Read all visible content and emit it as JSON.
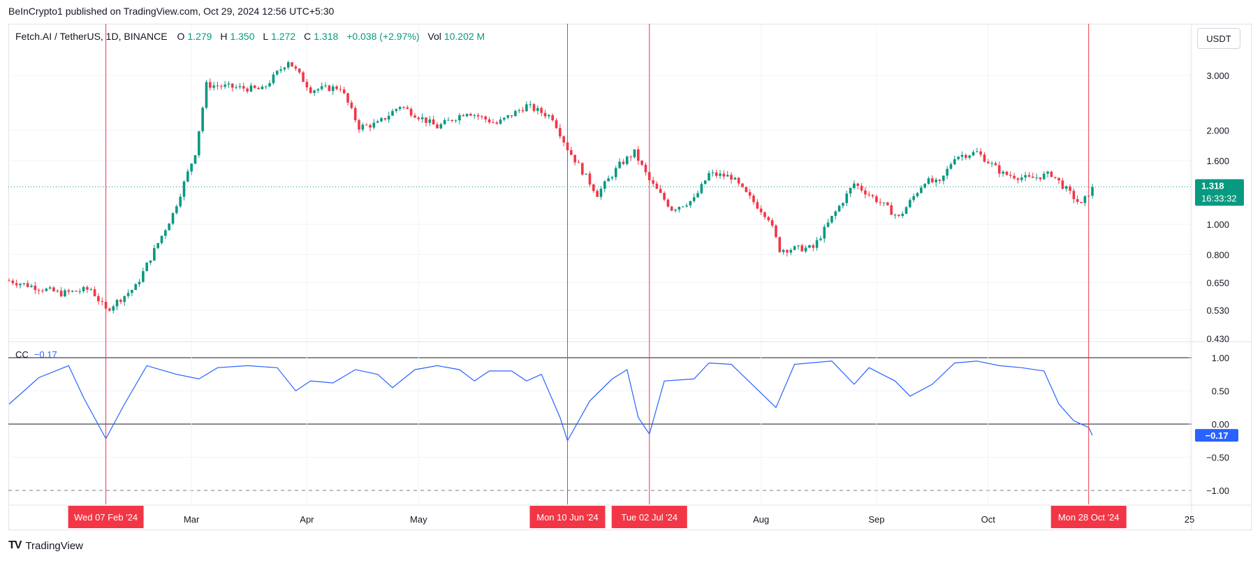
{
  "header": {
    "published": "BeInCrypto1 published on TradingView.com, Oct 29, 2024 12:56 UTC+5:30"
  },
  "legend": {
    "symbol": "Fetch.AI / TetherUS, 1D, BINANCE",
    "o_label": "O",
    "o_value": "1.279",
    "h_label": "H",
    "h_value": "1.350",
    "l_label": "L",
    "l_value": "1.272",
    "c_label": "C",
    "c_value": "1.318",
    "change": "+0.038 (+2.97%)",
    "vol_label": "Vol",
    "vol_value": "10.202 M"
  },
  "currency_button": "USDT",
  "price_tag": {
    "price": "1.318",
    "countdown": "16:33:32"
  },
  "indicator": {
    "name": "CC",
    "value": "−0.17",
    "tag": "−0.17"
  },
  "footer": {
    "logo": "TV",
    "brand": "TradingView"
  },
  "colors": {
    "up": "#089981",
    "down": "#f23645",
    "cc_line": "#2962ff",
    "marker_line": "#f23645",
    "marker_bg": "#f23645",
    "price_tag_bg": "#089981"
  },
  "chart_data": [
    {
      "type": "candlestick",
      "title": "Fetch.AI / TetherUS, 1D, BINANCE",
      "y_scale": "log",
      "y_ticks": [
        "3.000",
        "2.000",
        "1.600",
        "1.000",
        "0.800",
        "0.650",
        "0.530",
        "0.430"
      ],
      "x_ticks": [
        "Mar",
        "Apr",
        "May",
        "Aug",
        "Sep",
        "Oct",
        "25"
      ],
      "last_price": 1.318,
      "close_path": [
        {
          "date": "2024-01-12",
          "close": 0.66
        },
        {
          "date": "2024-01-26",
          "close": 0.6
        },
        {
          "date": "2024-02-03",
          "close": 0.62
        },
        {
          "date": "2024-02-07",
          "close": 0.53
        },
        {
          "date": "2024-02-15",
          "close": 0.63
        },
        {
          "date": "2024-02-25",
          "close": 1.08
        },
        {
          "date": "2024-03-02",
          "close": 1.7
        },
        {
          "date": "2024-03-05",
          "close": 2.8
        },
        {
          "date": "2024-03-12",
          "close": 2.75
        },
        {
          "date": "2024-03-20",
          "close": 2.7
        },
        {
          "date": "2024-03-27",
          "close": 3.35
        },
        {
          "date": "2024-04-02",
          "close": 2.7
        },
        {
          "date": "2024-04-10",
          "close": 2.75
        },
        {
          "date": "2024-04-15",
          "close": 2.05
        },
        {
          "date": "2024-04-20",
          "close": 2.1
        },
        {
          "date": "2024-04-26",
          "close": 2.4
        },
        {
          "date": "2024-05-06",
          "close": 2.05
        },
        {
          "date": "2024-05-14",
          "close": 2.3
        },
        {
          "date": "2024-05-22",
          "close": 2.1
        },
        {
          "date": "2024-05-30",
          "close": 2.4
        },
        {
          "date": "2024-06-06",
          "close": 2.2
        },
        {
          "date": "2024-06-10",
          "close": 1.75
        },
        {
          "date": "2024-06-18",
          "close": 1.25
        },
        {
          "date": "2024-06-24",
          "close": 1.55
        },
        {
          "date": "2024-06-28",
          "close": 1.7
        },
        {
          "date": "2024-07-02",
          "close": 1.38
        },
        {
          "date": "2024-07-08",
          "close": 1.12
        },
        {
          "date": "2024-07-14",
          "close": 1.2
        },
        {
          "date": "2024-07-18",
          "close": 1.45
        },
        {
          "date": "2024-07-24",
          "close": 1.42
        },
        {
          "date": "2024-07-28",
          "close": 1.25
        },
        {
          "date": "2024-08-03",
          "close": 1.05
        },
        {
          "date": "2024-08-06",
          "close": 0.83
        },
        {
          "date": "2024-08-15",
          "close": 0.84
        },
        {
          "date": "2024-08-20",
          "close": 1.05
        },
        {
          "date": "2024-08-26",
          "close": 1.35
        },
        {
          "date": "2024-09-03",
          "close": 1.15
        },
        {
          "date": "2024-09-07",
          "close": 1.05
        },
        {
          "date": "2024-09-14",
          "close": 1.38
        },
        {
          "date": "2024-09-18",
          "close": 1.35
        },
        {
          "date": "2024-09-22",
          "close": 1.65
        },
        {
          "date": "2024-09-28",
          "close": 1.7
        },
        {
          "date": "2024-10-05",
          "close": 1.45
        },
        {
          "date": "2024-10-12",
          "close": 1.4
        },
        {
          "date": "2024-10-18",
          "close": 1.45
        },
        {
          "date": "2024-10-26",
          "close": 1.15
        },
        {
          "date": "2024-10-29",
          "close": 1.318
        }
      ]
    },
    {
      "type": "line",
      "name": "CC",
      "y_ticks": [
        "1.00",
        "0.50",
        "0.00",
        "−0.50",
        "−1.00"
      ],
      "ylim": [
        -1.0,
        1.0
      ],
      "last_value": -0.17,
      "series": [
        {
          "date": "2024-01-12",
          "value": 0.3
        },
        {
          "date": "2024-01-20",
          "value": 0.7
        },
        {
          "date": "2024-01-28",
          "value": 0.88
        },
        {
          "date": "2024-02-01",
          "value": 0.4
        },
        {
          "date": "2024-02-07",
          "value": -0.22
        },
        {
          "date": "2024-02-12",
          "value": 0.3
        },
        {
          "date": "2024-02-18",
          "value": 0.88
        },
        {
          "date": "2024-02-26",
          "value": 0.75
        },
        {
          "date": "2024-03-03",
          "value": 0.68
        },
        {
          "date": "2024-03-08",
          "value": 0.85
        },
        {
          "date": "2024-03-16",
          "value": 0.88
        },
        {
          "date": "2024-03-24",
          "value": 0.85
        },
        {
          "date": "2024-03-29",
          "value": 0.5
        },
        {
          "date": "2024-04-02",
          "value": 0.65
        },
        {
          "date": "2024-04-08",
          "value": 0.62
        },
        {
          "date": "2024-04-14",
          "value": 0.82
        },
        {
          "date": "2024-04-20",
          "value": 0.75
        },
        {
          "date": "2024-04-24",
          "value": 0.55
        },
        {
          "date": "2024-04-30",
          "value": 0.82
        },
        {
          "date": "2024-05-06",
          "value": 0.88
        },
        {
          "date": "2024-05-12",
          "value": 0.82
        },
        {
          "date": "2024-05-16",
          "value": 0.65
        },
        {
          "date": "2024-05-20",
          "value": 0.8
        },
        {
          "date": "2024-05-26",
          "value": 0.8
        },
        {
          "date": "2024-05-30",
          "value": 0.65
        },
        {
          "date": "2024-06-03",
          "value": 0.75
        },
        {
          "date": "2024-06-08",
          "value": 0.1
        },
        {
          "date": "2024-06-10",
          "value": -0.25
        },
        {
          "date": "2024-06-16",
          "value": 0.35
        },
        {
          "date": "2024-06-22",
          "value": 0.68
        },
        {
          "date": "2024-06-26",
          "value": 0.82
        },
        {
          "date": "2024-06-29",
          "value": 0.1
        },
        {
          "date": "2024-07-02",
          "value": -0.15
        },
        {
          "date": "2024-07-06",
          "value": 0.65
        },
        {
          "date": "2024-07-14",
          "value": 0.68
        },
        {
          "date": "2024-07-18",
          "value": 0.92
        },
        {
          "date": "2024-07-24",
          "value": 0.9
        },
        {
          "date": "2024-08-05",
          "value": 0.25
        },
        {
          "date": "2024-08-10",
          "value": 0.9
        },
        {
          "date": "2024-08-20",
          "value": 0.95
        },
        {
          "date": "2024-08-26",
          "value": 0.6
        },
        {
          "date": "2024-08-30",
          "value": 0.85
        },
        {
          "date": "2024-09-06",
          "value": 0.65
        },
        {
          "date": "2024-09-10",
          "value": 0.42
        },
        {
          "date": "2024-09-16",
          "value": 0.6
        },
        {
          "date": "2024-09-22",
          "value": 0.92
        },
        {
          "date": "2024-09-28",
          "value": 0.95
        },
        {
          "date": "2024-10-04",
          "value": 0.88
        },
        {
          "date": "2024-10-10",
          "value": 0.85
        },
        {
          "date": "2024-10-16",
          "value": 0.8
        },
        {
          "date": "2024-10-20",
          "value": 0.3
        },
        {
          "date": "2024-10-24",
          "value": 0.05
        },
        {
          "date": "2024-10-28",
          "value": -0.05
        },
        {
          "date": "2024-10-29",
          "value": -0.17
        }
      ]
    }
  ],
  "markers": [
    {
      "date": "2024-02-07",
      "label": "Wed 07 Feb '24"
    },
    {
      "date": "2024-06-10",
      "label": "Mon 10 Jun '24"
    },
    {
      "date": "2024-07-02",
      "label": "Tue 02 Jul '24"
    },
    {
      "date": "2024-10-28",
      "label": "Mon 28 Oct '24"
    }
  ]
}
